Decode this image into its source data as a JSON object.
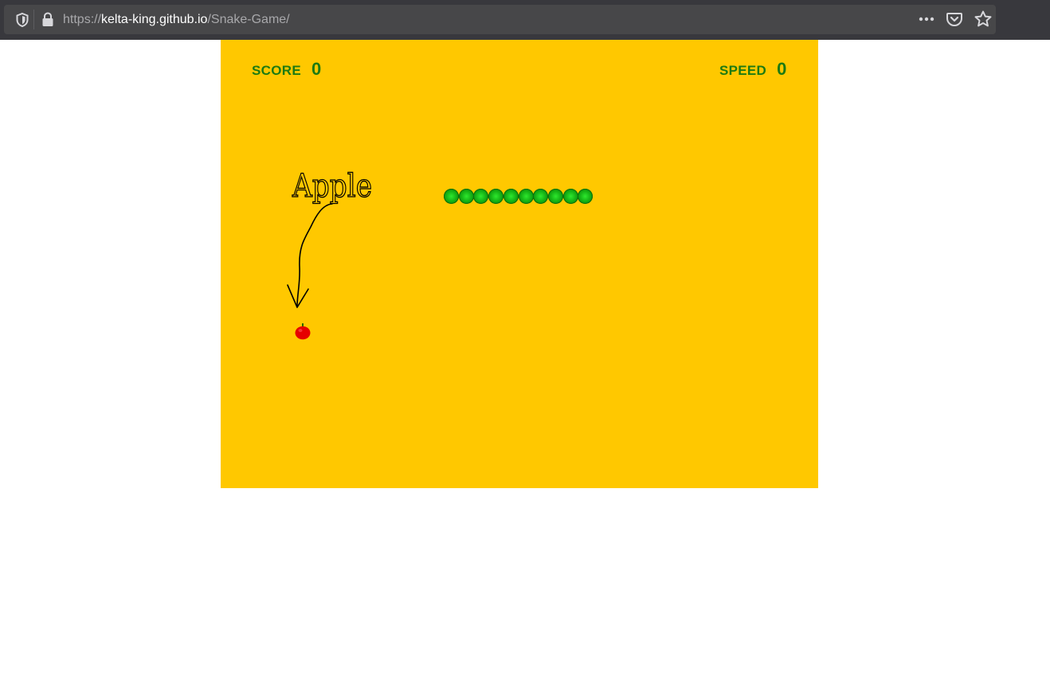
{
  "browser": {
    "url_scheme": "https://",
    "url_host": "kelta-king.github.io",
    "url_path": "/Snake-Game/"
  },
  "game": {
    "score_label": "SCORE",
    "score_value": "0",
    "speed_label": "SPEED",
    "speed_value": "0",
    "annotation_text": "Apple",
    "snake_length": 10,
    "board_color": "#ffc800",
    "text_color": "#1d7a12",
    "snake_color": "#16b516",
    "apple_color": "#e60000"
  }
}
